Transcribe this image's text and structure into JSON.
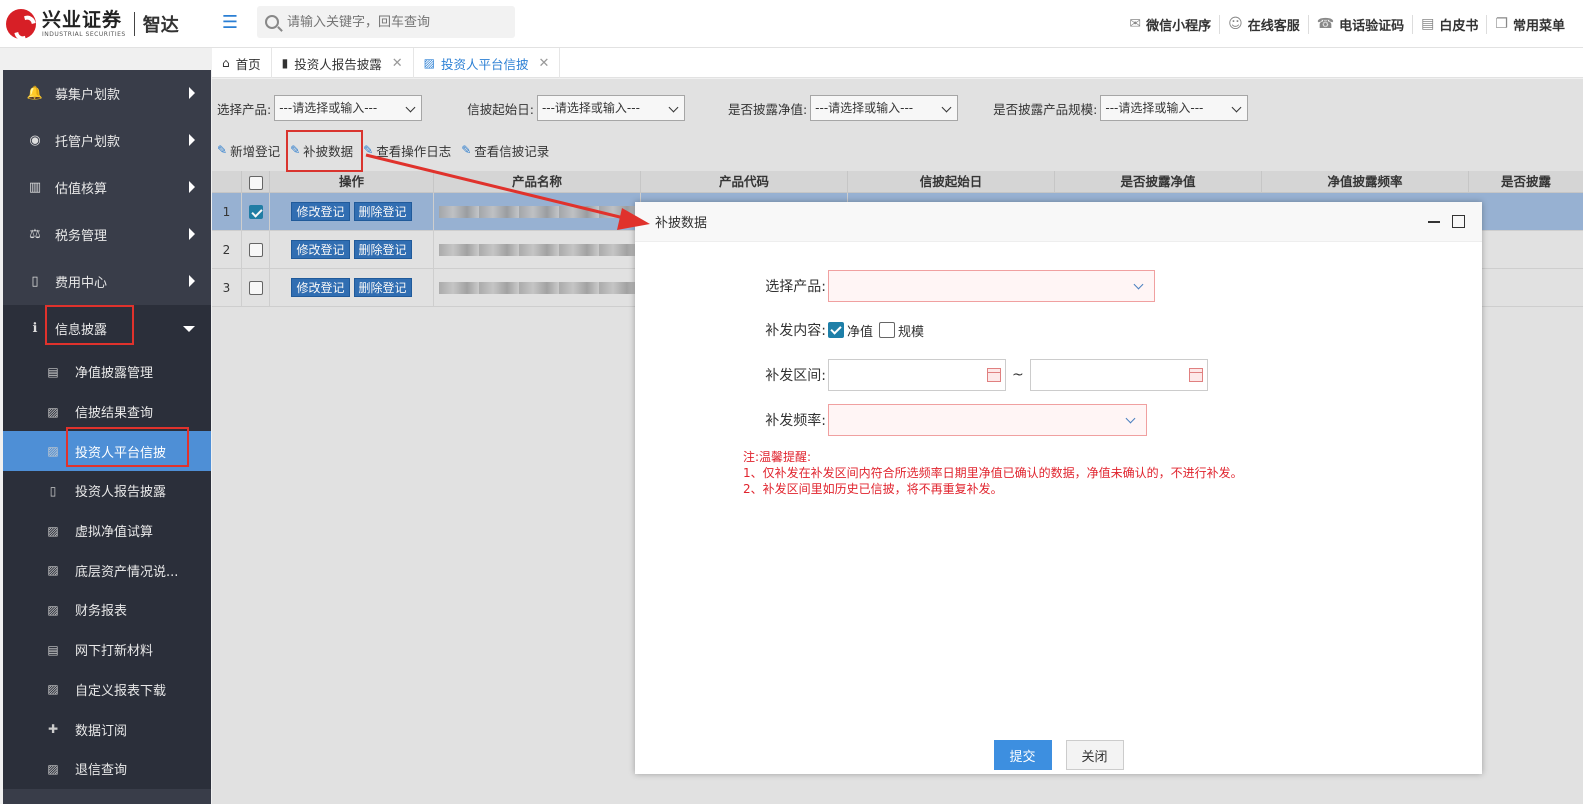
{
  "logo": {
    "cn": "兴业证券",
    "en": "INDUSTRIAL SECURITIES",
    "product": "智达"
  },
  "search": {
    "placeholder": "请输入关键字，回车查询"
  },
  "top_links": [
    {
      "icon": "wechat-icon",
      "label": "微信小程序"
    },
    {
      "icon": "headset-icon",
      "label": "在线客服"
    },
    {
      "icon": "phone-icon",
      "label": "电话验证码"
    },
    {
      "icon": "book-icon",
      "label": "白皮书"
    },
    {
      "icon": "menu-window-icon",
      "label": "常用菜单"
    }
  ],
  "sidebar": {
    "items": [
      {
        "icon": "bell-icon",
        "label": "募集户划款"
      },
      {
        "icon": "target-icon",
        "label": "托管户划款"
      },
      {
        "icon": "bar-chart-icon",
        "label": "估值核算"
      },
      {
        "icon": "scale-icon",
        "label": "税务管理"
      },
      {
        "icon": "file-icon",
        "label": "费用中心"
      },
      {
        "icon": "info-icon",
        "label": "信息披露"
      }
    ],
    "sub_items": [
      {
        "icon": "document-icon",
        "label": "净值披露管理"
      },
      {
        "icon": "image-file-icon",
        "label": "信披结果查询"
      },
      {
        "icon": "image-file-icon",
        "label": "投资人平台信披"
      },
      {
        "icon": "file-icon",
        "label": "投资人报告披露"
      },
      {
        "icon": "image-file-icon",
        "label": "虚拟净值试算"
      },
      {
        "icon": "image-file-icon",
        "label": "底层资产情况说..."
      },
      {
        "icon": "image-file-icon",
        "label": "财务报表"
      },
      {
        "icon": "document-icon",
        "label": "网下打新材料"
      },
      {
        "icon": "image-file-icon",
        "label": "自定义报表下载"
      },
      {
        "icon": "plus-box-icon",
        "label": "数据订阅"
      },
      {
        "icon": "image-file-icon",
        "label": "退信查询"
      }
    ]
  },
  "tabs": [
    {
      "icon": "home-icon",
      "label": "首页"
    },
    {
      "icon": "file-icon",
      "label": "投资人报告披露"
    },
    {
      "icon": "image-file-icon",
      "label": "投资人平台信披"
    }
  ],
  "filters": [
    {
      "label": "选择产品:",
      "value": "---请选择或输入---"
    },
    {
      "label": "信披起始日:",
      "value": "---请选择或输入---"
    },
    {
      "label": "是否披露净值:",
      "value": "---请选择或输入---"
    },
    {
      "label": "是否披露产品规模:",
      "value": "---请选择或输入---"
    }
  ],
  "toolbar": [
    "新增登记",
    "补披数据",
    "查看操作日志",
    "查看信披记录"
  ],
  "grid": {
    "headers": [
      "操作",
      "产品名称",
      "产品代码",
      "信披起始日",
      "是否披露净值",
      "净值披露频率",
      "是否披露"
    ],
    "rows": [
      {
        "no": "1",
        "checked": true
      },
      {
        "no": "2",
        "checked": false
      },
      {
        "no": "3",
        "checked": false
      }
    ],
    "edit_label": "修改登记",
    "delete_label": "删除登记"
  },
  "dialog": {
    "title": "补披数据",
    "product_label": "选择产品:",
    "content_label": "补发内容:",
    "content_options": [
      {
        "label": "净值",
        "checked": true
      },
      {
        "label": "规模",
        "checked": false
      }
    ],
    "range_label": "补发区间:",
    "range_sep": "~",
    "freq_label": "补发频率:",
    "notice_title": "注:温馨提醒:",
    "notice_lines": [
      "1、仅补发在补发区间内符合所选频率日期里净值已确认的数据，净值未确认的，不进行补发。",
      "2、补发区间里如历史已信披，将不再重复补发。"
    ],
    "submit_label": "提交",
    "close_label": "关闭"
  },
  "colors": {
    "accent": "#2b7fd4",
    "sidebar": "#393d49",
    "active": "#4e8fd6",
    "highlight": "#e0322c"
  }
}
